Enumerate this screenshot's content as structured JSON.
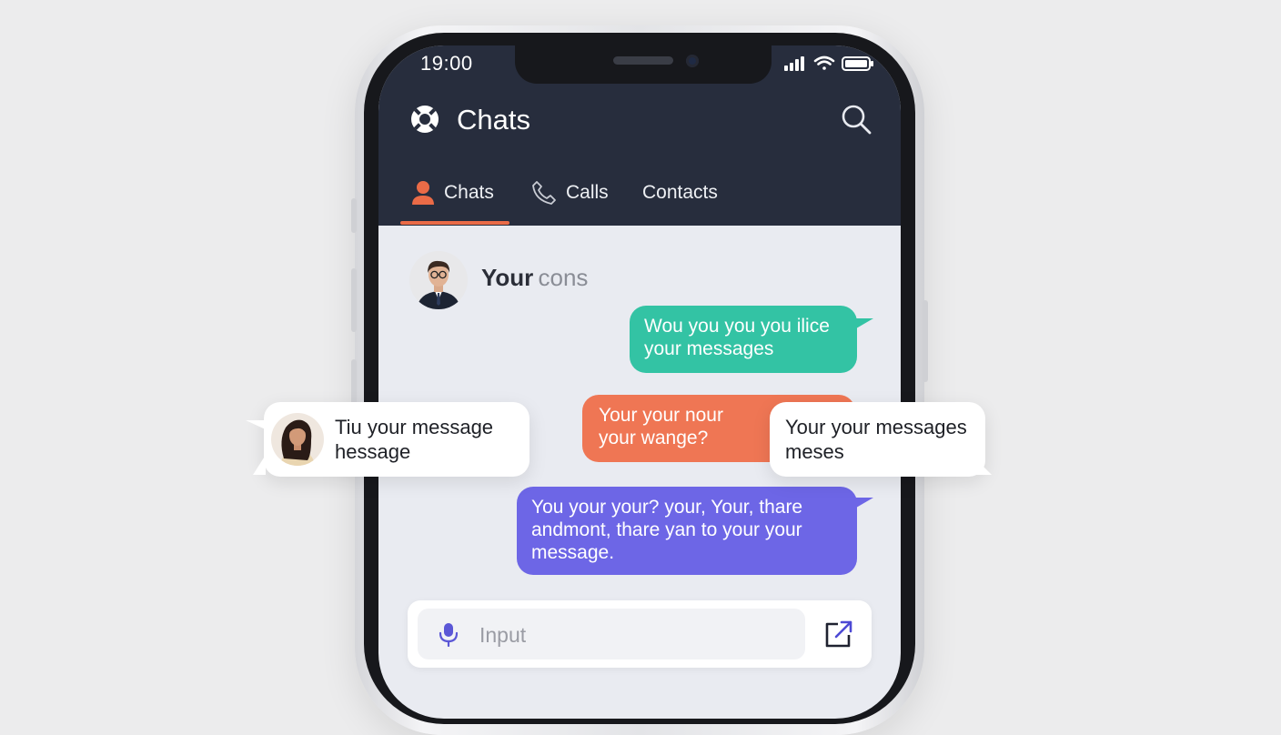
{
  "status_bar": {
    "time": "19:00"
  },
  "app_bar": {
    "title": "Chats",
    "logo_icon": "app-logo-icon",
    "search_icon": "search-icon"
  },
  "tabs": [
    {
      "label": "Chats",
      "icon": "person-icon",
      "active": true
    },
    {
      "label": "Calls",
      "icon": "phone-icon",
      "active": false
    },
    {
      "label": "Contacts",
      "active": false
    }
  ],
  "conversation": {
    "contact_name_bold": "Your",
    "contact_name_faded": " cons",
    "messages": [
      {
        "line1": "Wou you you you ilice",
        "line2": "your messages",
        "color": "#33c3a4"
      },
      {
        "line1": "Your your nour",
        "line2": "your wange?",
        "color": "#ef7654"
      },
      {
        "line1": "You your your? your,  Your, thare",
        "line2": "andmont, thare yan to your your",
        "line3": "message.",
        "color": "#6d66e6"
      }
    ]
  },
  "composer": {
    "placeholder": "Input",
    "mic_icon": "mic-icon",
    "send_icon": "send-icon"
  },
  "floating": {
    "left": {
      "line1": "Tiu your message",
      "line2": "hessage"
    },
    "right": {
      "line1": "Your your messages",
      "line2": "meses"
    }
  },
  "colors": {
    "header": "#272d3d",
    "accent": "#ea6b47",
    "screen_bg": "#e9ebf1"
  }
}
